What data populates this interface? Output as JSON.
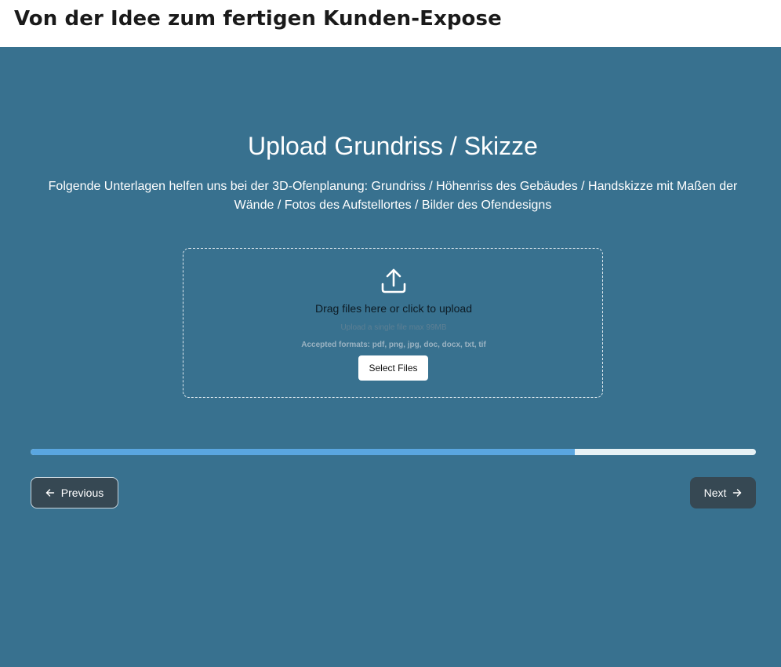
{
  "header": {
    "title": "Von der Idee zum fertigen Kunden-Expose"
  },
  "step": {
    "title": "Upload Grundriss / Skizze",
    "description": "Folgende Unterlagen helfen uns bei der 3D-Ofenplanung: Grundriss / Höhenriss des Gebäudes / Handskizze mit Maßen der Wände / Fotos des Aufstellortes / Bilder des Ofendesigns"
  },
  "upload": {
    "icon": "upload-icon",
    "title": "Drag files here or click to upload",
    "size_hint": "Upload a single file max 99MB",
    "formats_hint": "Accepted formats: pdf, png, jpg, doc, docx, txt, tif",
    "button_label": "Select Files"
  },
  "progress": {
    "fraction": 0.75,
    "fill_color": "#5aa6e0",
    "track_color": "#e6f1f5"
  },
  "navigation": {
    "previous_label": "Previous",
    "previous_icon": "arrow-left-icon",
    "next_label": "Next",
    "next_icon": "arrow-right-icon"
  },
  "colors": {
    "panel_background": "#38718f",
    "button_background": "#364853"
  }
}
